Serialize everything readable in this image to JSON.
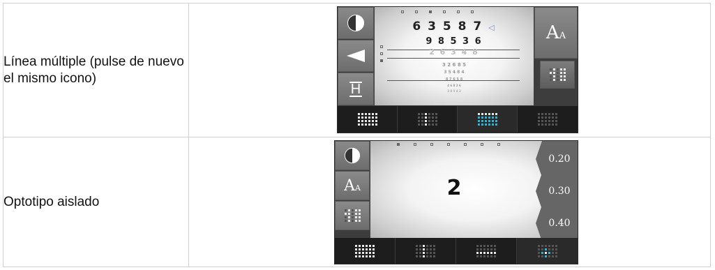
{
  "rows": [
    {
      "label": "Línea múltiple (pulse de nuevo el mismo icono)"
    },
    {
      "label": "Optotipo aislado"
    }
  ],
  "device1": {
    "chart_lines": [
      "6 3 5 8 7",
      "9 8 5 3 6",
      "2 6 3 4 8",
      "3 2 6 8 5",
      "3 5 4 8 4",
      "8 7 6 5 8",
      "4 6 8 2 6",
      "3 8 5 4 2"
    ],
    "arrow_glyph": "◁",
    "aa_big": "A",
    "aa_small": "A",
    "h_glyph": "H",
    "icons": [
      "contrast-icon",
      "arrow-left-icon",
      "h-letter-icon",
      "font-size-icon",
      "multi-line-icon"
    ]
  },
  "device2": {
    "optotype": "2",
    "aa_big": "A",
    "aa_small": "A",
    "levels": [
      "0.20",
      "0.30",
      "0.40"
    ],
    "icons": [
      "contrast-icon",
      "font-size-icon",
      "multi-line-icon"
    ]
  },
  "colors": {
    "accent": "#2fb3d6",
    "button": "#7a7a7a",
    "bar": "#1d1d1d"
  }
}
